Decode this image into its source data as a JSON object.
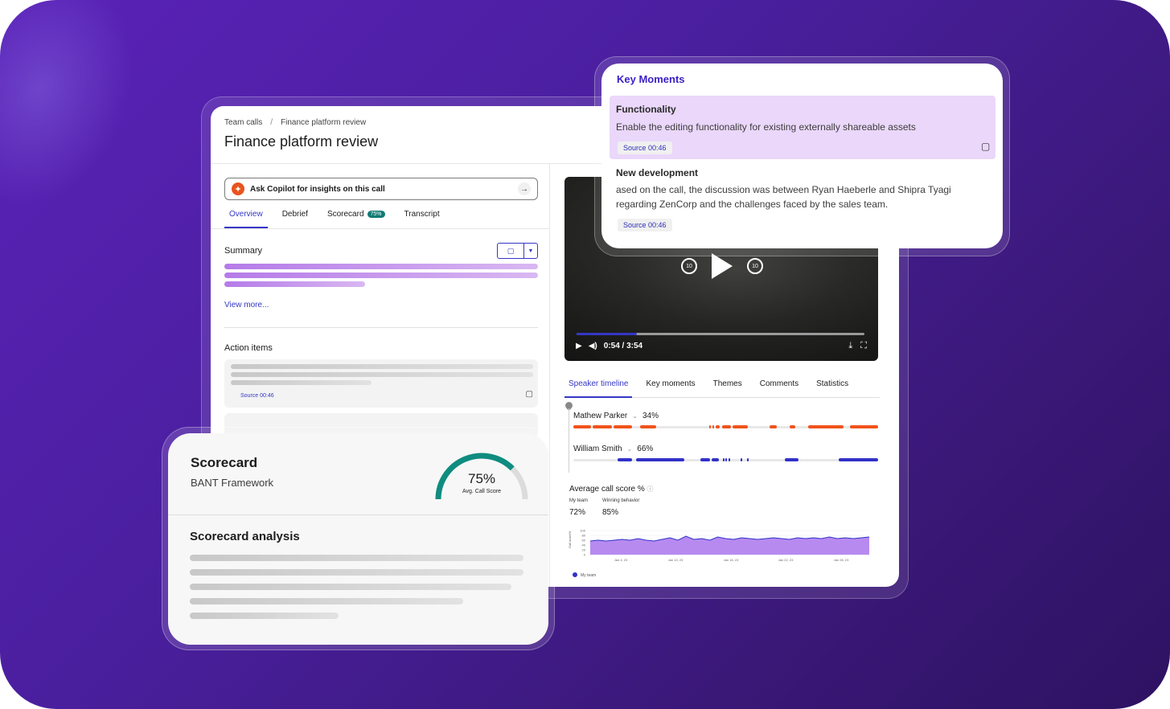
{
  "breadcrumb": {
    "root": "Team calls",
    "separator": "/",
    "current": "Finance platform review"
  },
  "page_title": "Finance platform review",
  "copilot": {
    "label": "Ask Copilot for insights on this call",
    "icon": "copilot-spark-icon",
    "arrow": "arrow-right-icon"
  },
  "left_tabs": [
    {
      "label": "Overview",
      "active": true
    },
    {
      "label": "Debrief"
    },
    {
      "label": "Scorecard",
      "badge": "75%"
    },
    {
      "label": "Transcript"
    }
  ],
  "summary": {
    "label": "Summary",
    "view_more": "View more..."
  },
  "action_items": {
    "label": "Action items",
    "source": "Source 00:46"
  },
  "video": {
    "time": "0:54 / 3:54",
    "progress": 0.21,
    "rewind": "10",
    "forward": "10"
  },
  "right_tabs": [
    {
      "label": "Speaker timeline",
      "active": true
    },
    {
      "label": "Key moments"
    },
    {
      "label": "Themes"
    },
    {
      "label": "Comments"
    },
    {
      "label": "Statistics"
    }
  ],
  "speakers": [
    {
      "name": "Mathew Parker",
      "share": "34%",
      "color": "#f0531c"
    },
    {
      "name": "William Smith",
      "share": "66%",
      "color": "#3131c8"
    }
  ],
  "avg_score": {
    "label": "Average call score %",
    "my_team_label": "My team",
    "winning_label": "Winning behavior",
    "my_team_value": "72%",
    "winning_value": "85%",
    "ylabel": "Call score%",
    "y_ticks": [
      "100",
      "80",
      "60",
      "40",
      "20",
      "0"
    ],
    "x_ticks": [
      "Jan 4, 23",
      "Jan 10, 23",
      "Jan 16, 23",
      "Jan 22, 23",
      "Jan 28, 23"
    ],
    "legend": "My team",
    "series_color": "#3131c8",
    "fill_color": "#b78af0"
  },
  "key_moments": {
    "title": "Key Moments",
    "items": [
      {
        "heading": "Functionality",
        "text": "Enable the editing functionality for existing externally shareable assets",
        "source": "Source 00:46"
      },
      {
        "heading": "New development",
        "text1": "ased on the call, the discussion was between Ryan Haeberle and Shipra Tyagi",
        "text2": "regarding ZenCorp and the challenges faced by the sales team.",
        "source": "Source 00:46"
      }
    ]
  },
  "scorecard": {
    "title": "Scorecard",
    "subtitle": "BANT Framework",
    "score": "75%",
    "score_value": 0.75,
    "score_label": "Avg. Call Score",
    "analysis_title": "Scorecard analysis",
    "gauge_color": "#0f8c80"
  }
}
